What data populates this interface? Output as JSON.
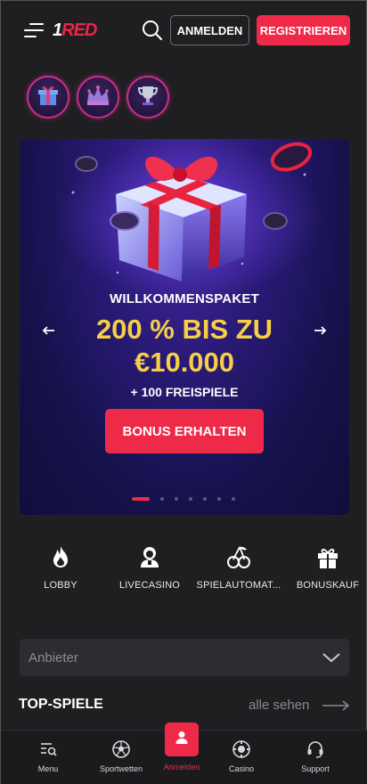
{
  "header": {
    "logo_text_one": "1",
    "logo_text_red": "RED",
    "login_label": "ANMELDEN",
    "register_label": "REGISTRIEREN"
  },
  "promo_icons": [
    "gift-icon",
    "crown-icon",
    "trophy-icon"
  ],
  "banner": {
    "kicker": "WILLKOMMENSPAKET",
    "headline_line1": "200 % BIS ZU",
    "headline_line2": "€10.000",
    "subline": "+ 100 FREISPIELE",
    "cta_label": "BONUS ERHALTEN",
    "slide_count": 6,
    "active_slide": 1
  },
  "categories": [
    {
      "icon": "flame-icon",
      "label": "LOBBY"
    },
    {
      "icon": "dealer-icon",
      "label": "LIVECASINO"
    },
    {
      "icon": "cherries-icon",
      "label": "SPIELAUTOMAT..."
    },
    {
      "icon": "gift-icon",
      "label": "BONUSKAUF"
    }
  ],
  "provider_select": {
    "placeholder": "Anbieter"
  },
  "top_games": {
    "title": "TOP-SPIELE",
    "see_all": "alle sehen"
  },
  "bottom_nav": [
    {
      "icon": "menu-search-icon",
      "label": "Menu"
    },
    {
      "icon": "soccer-ball-icon",
      "label": "Sportwetten"
    },
    {
      "icon": "user-icon",
      "label": "Anmelden"
    },
    {
      "icon": "casino-chip-icon",
      "label": "Casino"
    },
    {
      "icon": "headset-icon",
      "label": "Support"
    }
  ],
  "colors": {
    "accent_red": "#ef2a48",
    "headline_gold": "#f5cf45",
    "background": "#1f1f22"
  }
}
